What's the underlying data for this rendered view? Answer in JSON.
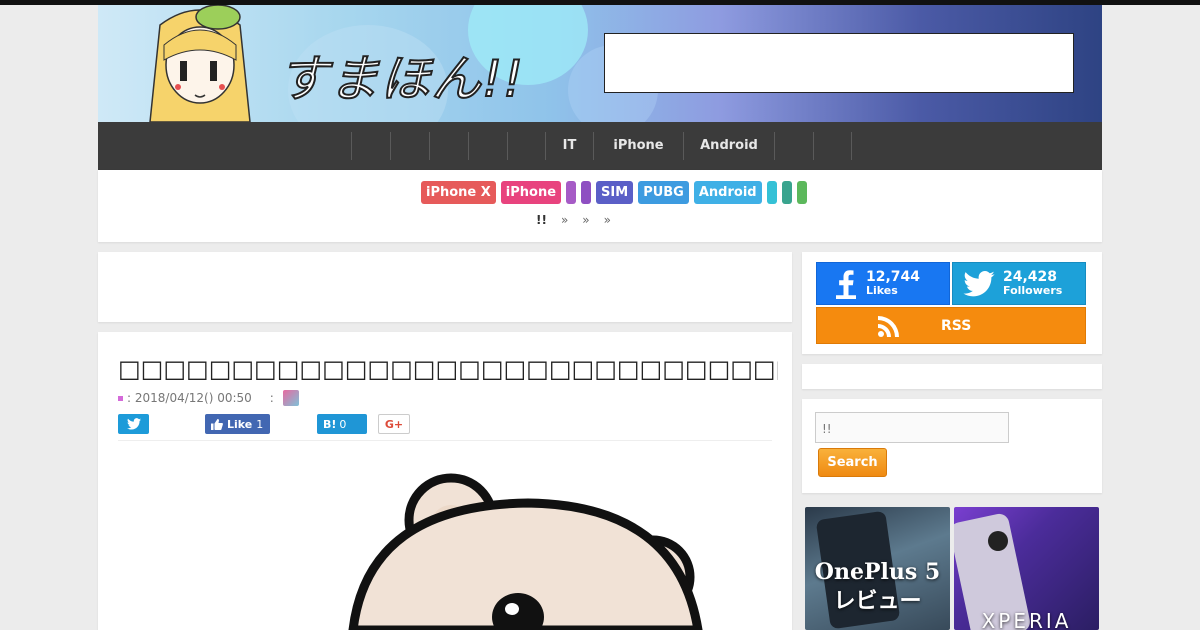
{
  "site": {
    "logo_text": "すまほん!!"
  },
  "nav": {
    "items": [
      "",
      "",
      "",
      "",
      "",
      "IT",
      "iPhone",
      "Android",
      "",
      ""
    ]
  },
  "tags": [
    {
      "label": "iPhone X",
      "color": "#e65a5a"
    },
    {
      "label": "iPhone",
      "color": "#e8437e"
    },
    {
      "label": "",
      "color": "#a65bc6"
    },
    {
      "label": "",
      "color": "#8e4fc2"
    },
    {
      "label": "SIM",
      "color": "#5b5fc7"
    },
    {
      "label": "PUBG",
      "color": "#3d9be0"
    },
    {
      "label": "Android",
      "color": "#3fb0e6"
    },
    {
      "label": "",
      "color": "#35c1d6"
    },
    {
      "label": "",
      "color": "#39a48e"
    },
    {
      "label": "",
      "color": "#5cb85c"
    }
  ],
  "breadcrumb": {
    "home": "!!",
    "sep1": "»",
    "sep2": "»",
    "sep3": "»"
  },
  "article": {
    "title": "□□□□□□□□□□□□□□□□□□□□□□□□□□□□□□□□□",
    "date_label": ": 2018/04/12() 00:50",
    "author_sep": ":"
  },
  "share": {
    "fb_label": "Like",
    "fb_count": "1",
    "hatena_label": "B!",
    "hatena_count": "0",
    "gplus_label": "G+"
  },
  "sidebar": {
    "facebook": {
      "count": "12,744",
      "label": "Likes"
    },
    "twitter": {
      "count": "24,428",
      "label": "Followers"
    },
    "rss": {
      "label": "RSS"
    },
    "search": {
      "placeholder": "!!",
      "button": "Search"
    },
    "thumbs": [
      {
        "line1": "OnePlus 5",
        "line2": "レビュー"
      },
      {
        "line1": "XPERIA"
      }
    ]
  },
  "colors": {
    "facebook": "#1877f2",
    "twitter": "#1da1d9",
    "rss": "#f58b0e",
    "nav_bg": "#3b3b3b"
  }
}
